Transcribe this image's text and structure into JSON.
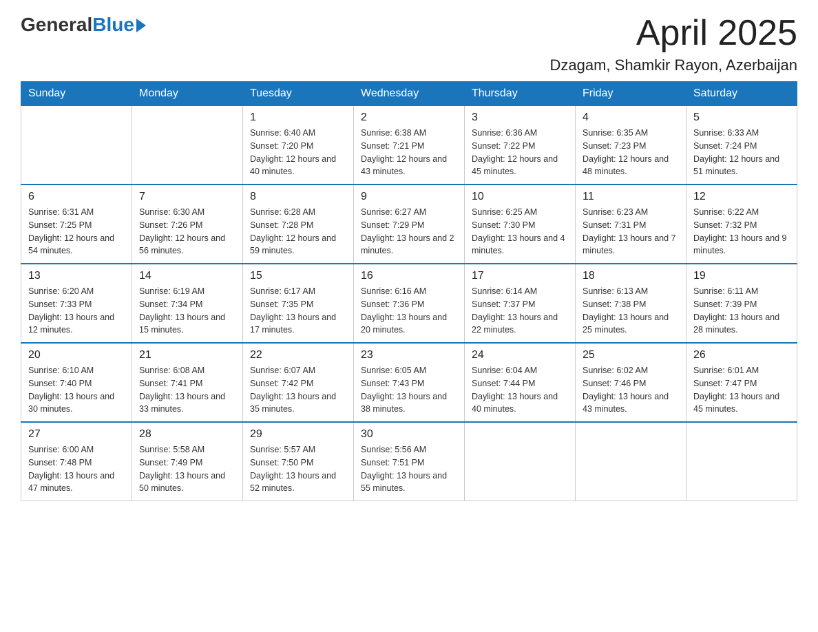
{
  "header": {
    "logo": {
      "general": "General",
      "blue": "Blue"
    },
    "title": "April 2025",
    "location": "Dzagam, Shamkir Rayon, Azerbaijan"
  },
  "weekdays": [
    "Sunday",
    "Monday",
    "Tuesday",
    "Wednesday",
    "Thursday",
    "Friday",
    "Saturday"
  ],
  "weeks": [
    [
      {
        "day": "",
        "sunrise": "",
        "sunset": "",
        "daylight": ""
      },
      {
        "day": "",
        "sunrise": "",
        "sunset": "",
        "daylight": ""
      },
      {
        "day": "1",
        "sunrise": "Sunrise: 6:40 AM",
        "sunset": "Sunset: 7:20 PM",
        "daylight": "Daylight: 12 hours and 40 minutes."
      },
      {
        "day": "2",
        "sunrise": "Sunrise: 6:38 AM",
        "sunset": "Sunset: 7:21 PM",
        "daylight": "Daylight: 12 hours and 43 minutes."
      },
      {
        "day": "3",
        "sunrise": "Sunrise: 6:36 AM",
        "sunset": "Sunset: 7:22 PM",
        "daylight": "Daylight: 12 hours and 45 minutes."
      },
      {
        "day": "4",
        "sunrise": "Sunrise: 6:35 AM",
        "sunset": "Sunset: 7:23 PM",
        "daylight": "Daylight: 12 hours and 48 minutes."
      },
      {
        "day": "5",
        "sunrise": "Sunrise: 6:33 AM",
        "sunset": "Sunset: 7:24 PM",
        "daylight": "Daylight: 12 hours and 51 minutes."
      }
    ],
    [
      {
        "day": "6",
        "sunrise": "Sunrise: 6:31 AM",
        "sunset": "Sunset: 7:25 PM",
        "daylight": "Daylight: 12 hours and 54 minutes."
      },
      {
        "day": "7",
        "sunrise": "Sunrise: 6:30 AM",
        "sunset": "Sunset: 7:26 PM",
        "daylight": "Daylight: 12 hours and 56 minutes."
      },
      {
        "day": "8",
        "sunrise": "Sunrise: 6:28 AM",
        "sunset": "Sunset: 7:28 PM",
        "daylight": "Daylight: 12 hours and 59 minutes."
      },
      {
        "day": "9",
        "sunrise": "Sunrise: 6:27 AM",
        "sunset": "Sunset: 7:29 PM",
        "daylight": "Daylight: 13 hours and 2 minutes."
      },
      {
        "day": "10",
        "sunrise": "Sunrise: 6:25 AM",
        "sunset": "Sunset: 7:30 PM",
        "daylight": "Daylight: 13 hours and 4 minutes."
      },
      {
        "day": "11",
        "sunrise": "Sunrise: 6:23 AM",
        "sunset": "Sunset: 7:31 PM",
        "daylight": "Daylight: 13 hours and 7 minutes."
      },
      {
        "day": "12",
        "sunrise": "Sunrise: 6:22 AM",
        "sunset": "Sunset: 7:32 PM",
        "daylight": "Daylight: 13 hours and 9 minutes."
      }
    ],
    [
      {
        "day": "13",
        "sunrise": "Sunrise: 6:20 AM",
        "sunset": "Sunset: 7:33 PM",
        "daylight": "Daylight: 13 hours and 12 minutes."
      },
      {
        "day": "14",
        "sunrise": "Sunrise: 6:19 AM",
        "sunset": "Sunset: 7:34 PM",
        "daylight": "Daylight: 13 hours and 15 minutes."
      },
      {
        "day": "15",
        "sunrise": "Sunrise: 6:17 AM",
        "sunset": "Sunset: 7:35 PM",
        "daylight": "Daylight: 13 hours and 17 minutes."
      },
      {
        "day": "16",
        "sunrise": "Sunrise: 6:16 AM",
        "sunset": "Sunset: 7:36 PM",
        "daylight": "Daylight: 13 hours and 20 minutes."
      },
      {
        "day": "17",
        "sunrise": "Sunrise: 6:14 AM",
        "sunset": "Sunset: 7:37 PM",
        "daylight": "Daylight: 13 hours and 22 minutes."
      },
      {
        "day": "18",
        "sunrise": "Sunrise: 6:13 AM",
        "sunset": "Sunset: 7:38 PM",
        "daylight": "Daylight: 13 hours and 25 minutes."
      },
      {
        "day": "19",
        "sunrise": "Sunrise: 6:11 AM",
        "sunset": "Sunset: 7:39 PM",
        "daylight": "Daylight: 13 hours and 28 minutes."
      }
    ],
    [
      {
        "day": "20",
        "sunrise": "Sunrise: 6:10 AM",
        "sunset": "Sunset: 7:40 PM",
        "daylight": "Daylight: 13 hours and 30 minutes."
      },
      {
        "day": "21",
        "sunrise": "Sunrise: 6:08 AM",
        "sunset": "Sunset: 7:41 PM",
        "daylight": "Daylight: 13 hours and 33 minutes."
      },
      {
        "day": "22",
        "sunrise": "Sunrise: 6:07 AM",
        "sunset": "Sunset: 7:42 PM",
        "daylight": "Daylight: 13 hours and 35 minutes."
      },
      {
        "day": "23",
        "sunrise": "Sunrise: 6:05 AM",
        "sunset": "Sunset: 7:43 PM",
        "daylight": "Daylight: 13 hours and 38 minutes."
      },
      {
        "day": "24",
        "sunrise": "Sunrise: 6:04 AM",
        "sunset": "Sunset: 7:44 PM",
        "daylight": "Daylight: 13 hours and 40 minutes."
      },
      {
        "day": "25",
        "sunrise": "Sunrise: 6:02 AM",
        "sunset": "Sunset: 7:46 PM",
        "daylight": "Daylight: 13 hours and 43 minutes."
      },
      {
        "day": "26",
        "sunrise": "Sunrise: 6:01 AM",
        "sunset": "Sunset: 7:47 PM",
        "daylight": "Daylight: 13 hours and 45 minutes."
      }
    ],
    [
      {
        "day": "27",
        "sunrise": "Sunrise: 6:00 AM",
        "sunset": "Sunset: 7:48 PM",
        "daylight": "Daylight: 13 hours and 47 minutes."
      },
      {
        "day": "28",
        "sunrise": "Sunrise: 5:58 AM",
        "sunset": "Sunset: 7:49 PM",
        "daylight": "Daylight: 13 hours and 50 minutes."
      },
      {
        "day": "29",
        "sunrise": "Sunrise: 5:57 AM",
        "sunset": "Sunset: 7:50 PM",
        "daylight": "Daylight: 13 hours and 52 minutes."
      },
      {
        "day": "30",
        "sunrise": "Sunrise: 5:56 AM",
        "sunset": "Sunset: 7:51 PM",
        "daylight": "Daylight: 13 hours and 55 minutes."
      },
      {
        "day": "",
        "sunrise": "",
        "sunset": "",
        "daylight": ""
      },
      {
        "day": "",
        "sunrise": "",
        "sunset": "",
        "daylight": ""
      },
      {
        "day": "",
        "sunrise": "",
        "sunset": "",
        "daylight": ""
      }
    ]
  ]
}
